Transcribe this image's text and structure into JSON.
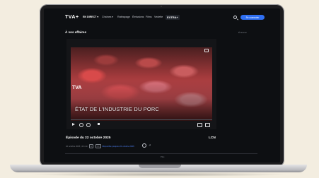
{
  "nav": {
    "logo": "TVA+",
    "direct": "EN DIRECT ▾",
    "items": [
      "Chaînes ▾",
      "Rattrapage",
      "Émissions",
      "Films",
      "Vedette"
    ],
    "extra": "EXTRA+",
    "connect": "Se connecter"
  },
  "page": {
    "section_title": "À vos affaires",
    "side_label": "Émission"
  },
  "video": {
    "channel_bug": "TVA",
    "overlay_title": "ÉTAT DE L'INDUSTRIE DU PORC",
    "progress": 0.0
  },
  "episode": {
    "title": "Épisode du 22 octobre 2025",
    "brand": "LCN",
    "date": "22 octobre 2025 | 22 min",
    "rating": "G",
    "tag": "CC",
    "link": "Disponible jusqu'au 21 octobre 2026"
  },
  "more": "Plus"
}
